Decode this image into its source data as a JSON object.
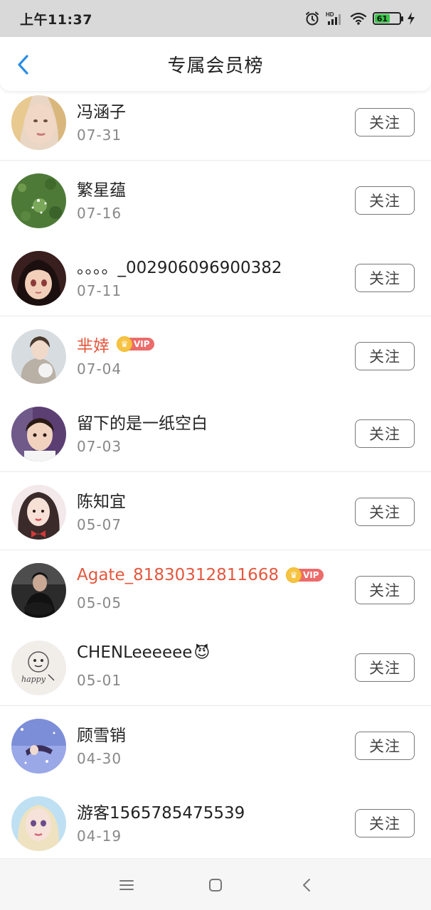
{
  "status_bar": {
    "time": "上午11:37",
    "battery_level": "61",
    "battery_fraction": 0.61,
    "icons": [
      "alarm-icon",
      "hd-signal-icon",
      "wifi-icon",
      "battery-icon",
      "charging-icon"
    ]
  },
  "header": {
    "title": "专属会员榜",
    "back_icon": "chevron-left-icon"
  },
  "members": [
    {
      "name": "冯涵子",
      "date": "07-31",
      "vip": false,
      "follow": "关注"
    },
    {
      "name": "繁星蕴",
      "date": "07-16",
      "vip": false,
      "follow": "关注"
    },
    {
      "name": "。。。。_002906096900382",
      "date": "07-11",
      "vip": false,
      "follow": "关注"
    },
    {
      "name": "芈婞",
      "date": "07-04",
      "vip": true,
      "vip_label": "VIP",
      "follow": "关注"
    },
    {
      "name": "留下的是一纸空白",
      "date": "07-03",
      "vip": false,
      "follow": "关注"
    },
    {
      "name": "陈知宜",
      "date": "05-07",
      "vip": false,
      "follow": "关注"
    },
    {
      "name": "Agate_81830312811668",
      "date": "05-05",
      "vip": true,
      "vip_label": "VIP",
      "follow": "关注"
    },
    {
      "name": "CHENLeeeeee",
      "date": "05-01",
      "vip": false,
      "emoji": "😈",
      "follow": "关注"
    },
    {
      "name": "顾雪销",
      "date": "04-30",
      "vip": false,
      "follow": "关注"
    },
    {
      "name": "游客1565785475539",
      "date": "04-19",
      "vip": false,
      "follow": "关注"
    }
  ],
  "colors": {
    "accent": "#2b8fe6",
    "vip_name": "#e4573d",
    "vip_badge": "#ec6b6b",
    "crown": "#f6c343"
  },
  "bottom_nav": {
    "icons": [
      "menu-icon",
      "home-square-icon",
      "back-triangle-icon"
    ]
  }
}
